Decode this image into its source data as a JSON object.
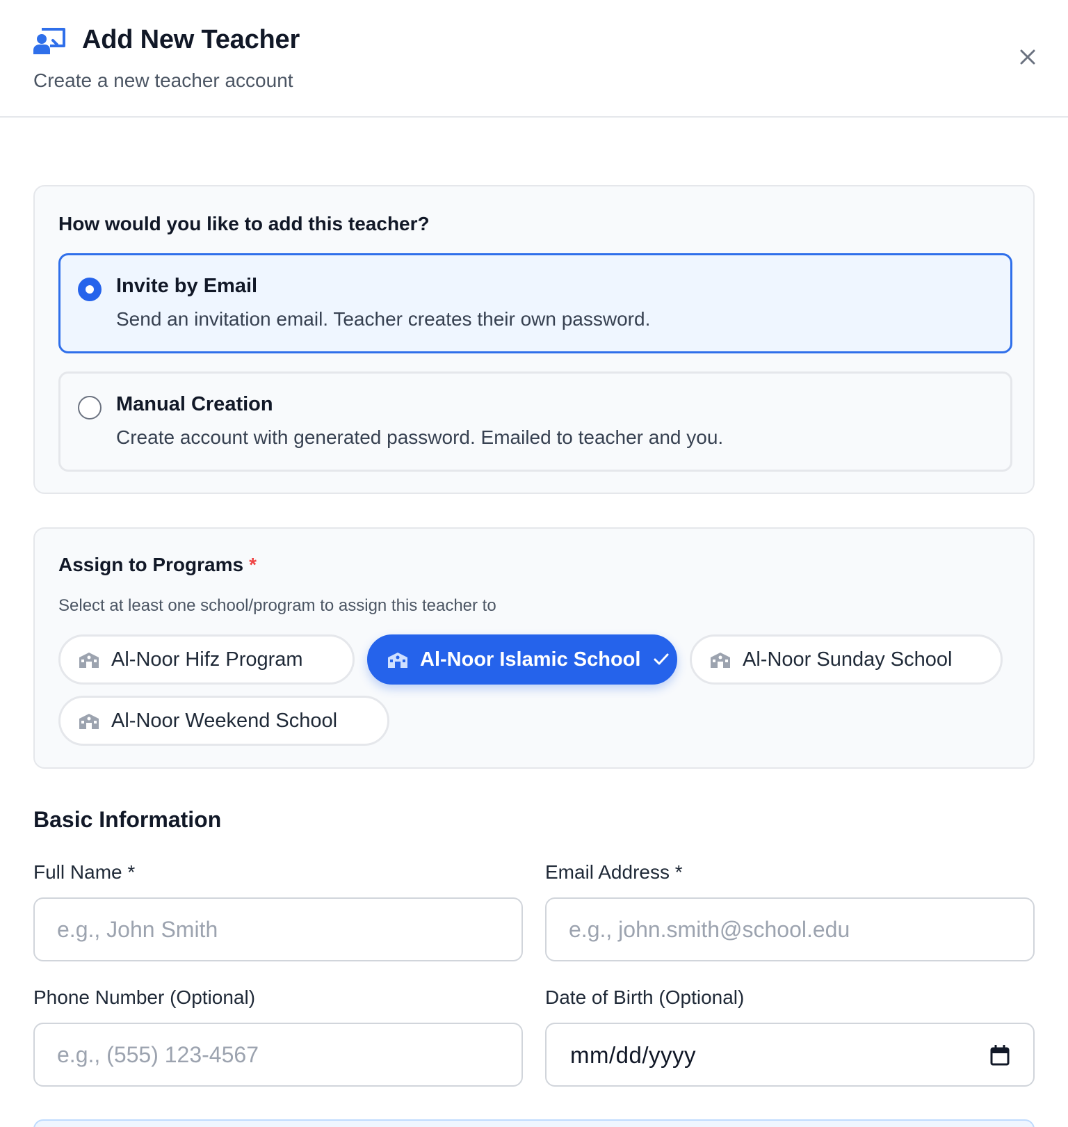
{
  "header": {
    "title": "Add New Teacher",
    "subtitle": "Create a new teacher account",
    "icon": "teacher-board-icon",
    "close_icon": "close-icon"
  },
  "method": {
    "question": "How would you like to add this teacher?",
    "options": [
      {
        "title": "Invite by Email",
        "description": "Send an invitation email. Teacher creates their own password.",
        "selected": true
      },
      {
        "title": "Manual Creation",
        "description": "Create account with generated password. Emailed to teacher and you.",
        "selected": false
      }
    ]
  },
  "programs": {
    "title": "Assign to Programs",
    "required_mark": "*",
    "hint": "Select at least one school/program to assign this teacher to",
    "chip_icon": "school-icon",
    "items": [
      {
        "label": "Al-Noor Hifz Program",
        "selected": false
      },
      {
        "label": "Al-Noor Islamic School",
        "selected": true
      },
      {
        "label": "Al-Noor Sunday School",
        "selected": false
      },
      {
        "label": "Al-Noor Weekend School",
        "selected": false
      }
    ]
  },
  "basic": {
    "title": "Basic Information",
    "full_name": {
      "label": "Full Name *",
      "placeholder": "e.g., John Smith",
      "value": ""
    },
    "email": {
      "label": "Email Address *",
      "placeholder": "e.g., john.smith@school.edu",
      "value": ""
    },
    "phone": {
      "label": "Phone Number (Optional)",
      "placeholder": "e.g., (555) 123-4567",
      "value": ""
    },
    "dob": {
      "label": "Date of Birth (Optional)",
      "value": "mm/dd/yyyy",
      "icon": "calendar-icon"
    }
  },
  "colors": {
    "accent": "#2563eb",
    "selected_bg": "#eff6ff",
    "card_bg": "#f8fafc",
    "border": "#e5e7eb",
    "required": "#ef4444"
  }
}
